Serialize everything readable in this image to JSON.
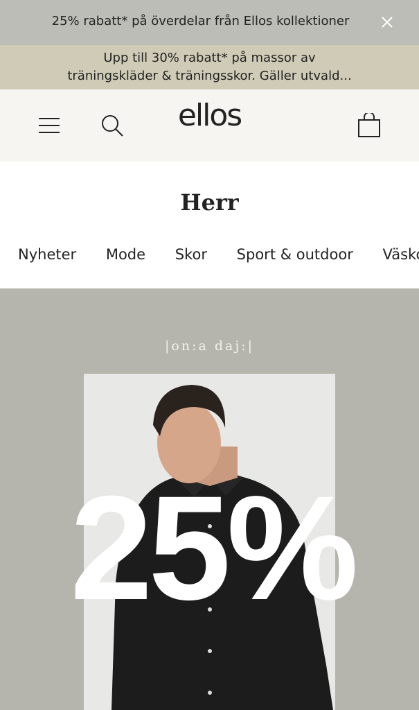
{
  "top_banner": {
    "text": "25% rabatt* på överdelar från Ellos kollektioner"
  },
  "promo_banner": {
    "line1": "Upp till 30% rabatt* på massor av",
    "line2": "träningskläder & träningsskor. Gäller utvald..."
  },
  "header": {
    "logo": "ellos"
  },
  "section": {
    "title": "Herr"
  },
  "nav": {
    "items": [
      {
        "label": "Nyheter"
      },
      {
        "label": "Mode"
      },
      {
        "label": "Skor"
      },
      {
        "label": "Sport & outdoor"
      },
      {
        "label": "Väskor"
      }
    ]
  },
  "hero": {
    "brand": "|on:a daj:|",
    "discount": "25%"
  },
  "colors": {
    "top_banner_bg": "#bdbdb7",
    "promo_banner_bg": "#cfcbb6",
    "header_bg": "#f7f5f2",
    "hero_bg": "#b6b5ad"
  }
}
